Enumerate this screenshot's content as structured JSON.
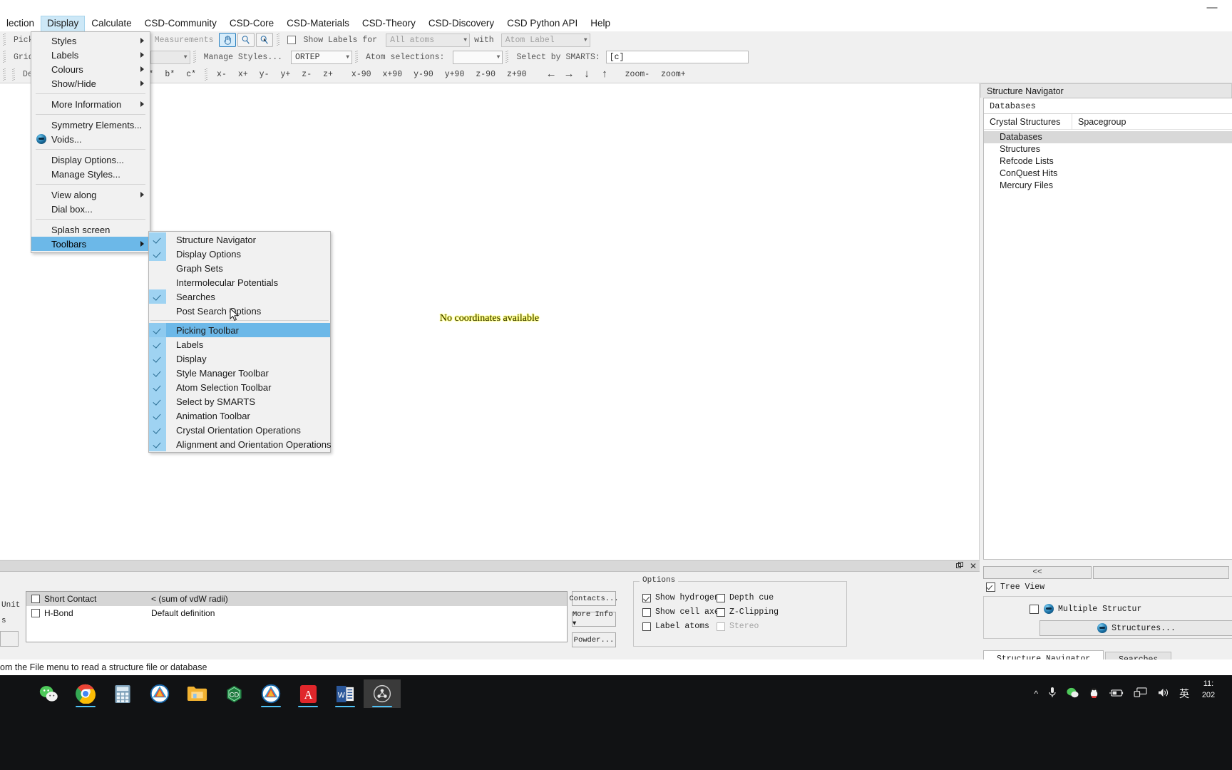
{
  "window": {
    "minimize_label": "—"
  },
  "menubar": {
    "items": [
      {
        "label": "lection",
        "active": false
      },
      {
        "label": "Display",
        "active": true
      },
      {
        "label": "Calculate",
        "active": false
      },
      {
        "label": "CSD-Community",
        "active": false
      },
      {
        "label": "CSD-Core",
        "active": false
      },
      {
        "label": "CSD-Materials",
        "active": false
      },
      {
        "label": "CSD-Theory",
        "active": false
      },
      {
        "label": "CSD-Discovery",
        "active": false
      },
      {
        "label": "CSD Python API",
        "active": false
      },
      {
        "label": "Help",
        "active": false
      }
    ]
  },
  "toolbars": {
    "row1": {
      "pick_atoms_label": "Pick At",
      "clear_measurements_label": "Clear Measurements",
      "mode_buttons": [
        {
          "icon": "hand-icon",
          "selected": true
        },
        {
          "icon": "magnifier-icon",
          "selected": false
        },
        {
          "icon": "pick-magnifier-icon",
          "selected": false
        }
      ],
      "show_labels_for_label": "Show Labels for",
      "show_labels_for_value": "All atoms",
      "with_label": "with",
      "atom_label_value": "Atom Label"
    },
    "row2": {
      "grid_label": "Grid",
      "manage_styles_label": "Manage Styles...",
      "style_value": "ORTEP",
      "atom_selections_label": "Atom selections:",
      "atom_selections_value": "",
      "select_by_smarts_label": "Select by SMARTS:",
      "smarts_value": "[c]"
    },
    "row3": {
      "default_label": "Defa",
      "axis_buttons": [
        "a*",
        "b*",
        "c*"
      ],
      "rotate_buttons": [
        "x-",
        "x+",
        "y-",
        "y+",
        "z-",
        "z+"
      ],
      "rotate90_buttons": [
        "x-90",
        "x+90",
        "y-90",
        "y+90",
        "z-90",
        "z+90"
      ],
      "arrow_buttons": [
        "←",
        "→",
        "↓",
        "↑"
      ],
      "zoom_buttons": [
        "zoom-",
        "zoom+"
      ]
    }
  },
  "canvas": {
    "message": "No coordinates available"
  },
  "display_menu": {
    "items": [
      {
        "label": "Styles",
        "submenu": true,
        "separator_after": false,
        "icon": null
      },
      {
        "label": "Labels",
        "submenu": true,
        "separator_after": false,
        "icon": null
      },
      {
        "label": "Colours",
        "submenu": true,
        "separator_after": false,
        "icon": null
      },
      {
        "label": "Show/Hide",
        "submenu": true,
        "separator_after": true,
        "icon": null
      },
      {
        "label": "More Information",
        "submenu": true,
        "separator_after": true,
        "icon": null
      },
      {
        "label": "Symmetry Elements...",
        "submenu": false,
        "separator_after": false,
        "icon": null
      },
      {
        "label": "Voids...",
        "submenu": false,
        "separator_after": true,
        "icon": "blue-orb-icon"
      },
      {
        "label": "Display Options...",
        "submenu": false,
        "separator_after": false,
        "icon": null
      },
      {
        "label": "Manage Styles...",
        "submenu": false,
        "separator_after": true,
        "icon": null
      },
      {
        "label": "View along",
        "submenu": true,
        "separator_after": false,
        "icon": null
      },
      {
        "label": "Dial box...",
        "submenu": false,
        "separator_after": true,
        "icon": null
      },
      {
        "label": "Splash screen",
        "submenu": false,
        "separator_after": false,
        "icon": null
      },
      {
        "label": "Toolbars",
        "submenu": true,
        "separator_after": false,
        "icon": null,
        "highlighted": true
      }
    ]
  },
  "toolbars_submenu": {
    "items": [
      {
        "label": "Structure Navigator",
        "checked": true,
        "highlighted": false,
        "separator_after": false
      },
      {
        "label": "Display Options",
        "checked": true,
        "highlighted": false,
        "separator_after": false
      },
      {
        "label": "Graph Sets",
        "checked": false,
        "highlighted": false,
        "separator_after": false
      },
      {
        "label": "Intermolecular Potentials",
        "checked": false,
        "highlighted": false,
        "separator_after": false
      },
      {
        "label": "Searches",
        "checked": true,
        "highlighted": false,
        "separator_after": false
      },
      {
        "label": "Post Search Options",
        "checked": false,
        "highlighted": false,
        "separator_after": true
      },
      {
        "label": "Picking Toolbar",
        "checked": true,
        "highlighted": true,
        "separator_after": false
      },
      {
        "label": "Labels",
        "checked": true,
        "highlighted": false,
        "separator_after": false
      },
      {
        "label": "Display",
        "checked": true,
        "highlighted": false,
        "separator_after": false
      },
      {
        "label": "Style Manager Toolbar",
        "checked": true,
        "highlighted": false,
        "separator_after": false
      },
      {
        "label": "Atom Selection Toolbar",
        "checked": true,
        "highlighted": false,
        "separator_after": false
      },
      {
        "label": "Select by SMARTS",
        "checked": true,
        "highlighted": false,
        "separator_after": false
      },
      {
        "label": "Animation Toolbar",
        "checked": true,
        "highlighted": false,
        "separator_after": false
      },
      {
        "label": "Crystal Orientation Operations",
        "checked": true,
        "highlighted": false,
        "separator_after": false
      },
      {
        "label": "Alignment and Orientation Operations",
        "checked": true,
        "highlighted": false,
        "separator_after": false
      }
    ]
  },
  "structure_navigator": {
    "title": "Structure Navigator",
    "search_value": "Databases",
    "columns": [
      "Crystal Structures",
      "Spacegroup"
    ],
    "items": [
      {
        "label": "Databases",
        "selected": true
      },
      {
        "label": "Structures",
        "selected": false
      },
      {
        "label": "Refcode Lists",
        "selected": false
      },
      {
        "label": "ConQuest Hits",
        "selected": false
      },
      {
        "label": "Mercury Files",
        "selected": false
      }
    ]
  },
  "bottom_panel": {
    "left_stub": [
      "Unit",
      "s"
    ],
    "contacts_rows": [
      {
        "label": "Short Contact",
        "definition": "< (sum of vdW radii)",
        "checked": false,
        "header": true
      },
      {
        "label": "H-Bond",
        "definition": "Default definition",
        "checked": false,
        "header": false
      }
    ],
    "side_buttons": [
      "Contacts...",
      "More Info ▾",
      "Powder..."
    ],
    "options": {
      "legend": "Options",
      "items": [
        {
          "label": "Show hydrogens",
          "checked": true,
          "disabled": false
        },
        {
          "label": "Show cell axes",
          "checked": false,
          "disabled": false
        },
        {
          "label": "Label atoms",
          "checked": false,
          "disabled": false
        },
        {
          "label": "Depth cue",
          "checked": false,
          "disabled": false
        },
        {
          "label": "Z-Clipping",
          "checked": false,
          "disabled": false
        },
        {
          "label": "Stereo",
          "checked": false,
          "disabled": true
        }
      ]
    }
  },
  "right_bottom": {
    "collapse_label": "<<",
    "tree_view_label": "Tree View",
    "tree_view_checked": true,
    "multiple_structures_label": "Multiple Structur",
    "multiple_structures_checked": false,
    "structures_button_label": "Structures...",
    "tabs": [
      {
        "label": "Structure Navigator",
        "active": true
      },
      {
        "label": "Searches",
        "active": false
      }
    ]
  },
  "statusbar": {
    "text": "om the File menu to read a structure file or database"
  },
  "taskbar": {
    "apps": [
      {
        "name": "wechat-icon",
        "active": false,
        "running": false
      },
      {
        "name": "chrome-icon",
        "active": false,
        "running": true
      },
      {
        "name": "calculator-icon",
        "active": false,
        "running": false
      },
      {
        "name": "mercury-icon",
        "active": false,
        "running": false
      },
      {
        "name": "file-explorer-icon",
        "active": false,
        "running": false
      },
      {
        "name": "conquest-icon",
        "active": false,
        "running": false
      },
      {
        "name": "mercury2-icon",
        "active": false,
        "running": true
      },
      {
        "name": "acrobat-icon",
        "active": false,
        "running": true
      },
      {
        "name": "word-icon",
        "active": false,
        "running": true
      },
      {
        "name": "mercury-app-icon",
        "active": true,
        "running": true
      }
    ],
    "tray": [
      {
        "name": "chevron-up-icon",
        "glyph": "^"
      },
      {
        "name": "microphone-icon",
        "glyph": "🎤"
      },
      {
        "name": "wechat-tray-icon",
        "glyph": ""
      },
      {
        "name": "qq-tray-icon",
        "glyph": ""
      },
      {
        "name": "battery-icon",
        "glyph": ""
      },
      {
        "name": "network-icon",
        "glyph": ""
      },
      {
        "name": "volume-icon",
        "glyph": ""
      },
      {
        "name": "ime-icon",
        "glyph": "英"
      }
    ],
    "clock": {
      "time": "11:",
      "date": "202"
    }
  },
  "colors": {
    "accent": "#6cb8e8",
    "check_bg": "#9fd3f2",
    "menu_bg": "#f1f1f1",
    "taskbar_bg": "#111214"
  }
}
